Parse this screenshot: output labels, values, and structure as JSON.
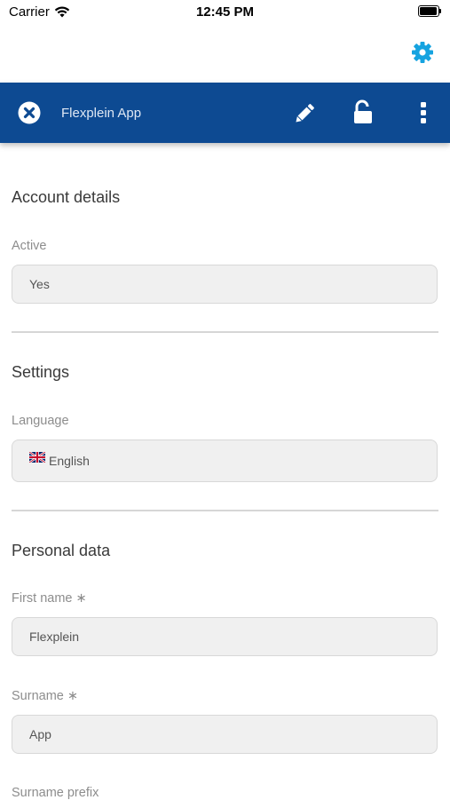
{
  "status_bar": {
    "carrier": "Carrier",
    "time": "12:45 PM"
  },
  "header": {
    "title": "Flexplein App",
    "bar_color": "#0d4a92",
    "accent_color": "#15a3e0",
    "icons": [
      "close-icon",
      "pencil-icon",
      "unlock-icon",
      "more-vertical-icon",
      "gear-icon"
    ]
  },
  "sections": {
    "account": {
      "title": "Account details",
      "active_label": "Active",
      "active_value": "Yes"
    },
    "settings": {
      "title": "Settings",
      "language_label": "Language",
      "language_value": "English"
    },
    "personal": {
      "title": "Personal data",
      "first_name_label": "First name ∗",
      "first_name_value": "Flexplein",
      "surname_label": "Surname ∗",
      "surname_value": "App",
      "surname_prefix_label": "Surname prefix"
    }
  }
}
